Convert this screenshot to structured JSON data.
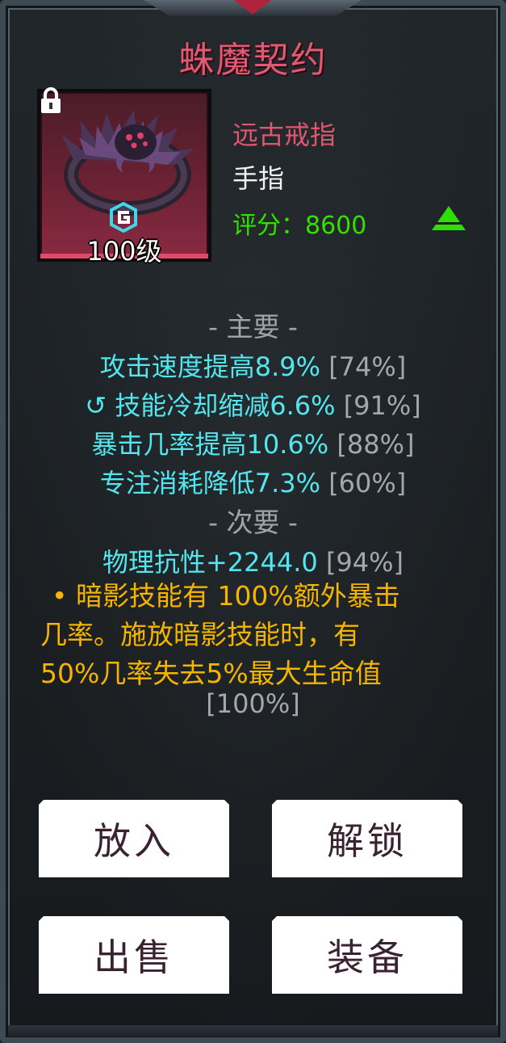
{
  "item": {
    "title": "蛛魔契约",
    "type": "远古戒指",
    "slot": "手指",
    "score_label": "评分：",
    "score_value": "8600",
    "level": "100级",
    "accent_color": "#e05a73",
    "score_color": "#33e000"
  },
  "main_section": {
    "header": "-  主要  -",
    "stats": [
      {
        "prefix": "",
        "text": "攻击速度提高8.9%",
        "pct": "[74%]"
      },
      {
        "prefix": "↺ ",
        "text": "技能冷却缩减6.6%",
        "pct": "[91%]"
      },
      {
        "prefix": "",
        "text": "暴击几率提高10.6%",
        "pct": "[88%]"
      },
      {
        "prefix": "",
        "text": "专注消耗降低7.3%",
        "pct": "[60%]"
      }
    ]
  },
  "secondary_section": {
    "header": "-  次要  -",
    "stat": {
      "text": "物理抗性+2244.0",
      "pct": "[94%]"
    },
    "legendary_lines": [
      "• 暗影技能有 100%额外暴击",
      "几率。施放暗影技能时，有",
      "50%几率失去5%最大生命值"
    ],
    "legendary_pct": "[100%]"
  },
  "buttons": {
    "put_in": "放入",
    "unlock": "解锁",
    "sell": "出售",
    "equip": "装备"
  },
  "icons": [
    "lock-icon",
    "ring-icon",
    "grade-g-icon",
    "upgrade-arrow-icon"
  ]
}
